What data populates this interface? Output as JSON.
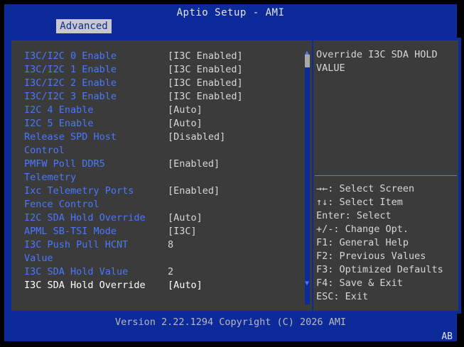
{
  "header": {
    "title": "Aptio Setup - AMI",
    "tab": "Advanced"
  },
  "settings": [
    {
      "label": "I3C/I2C 0 Enable",
      "value": "[I3C Enabled]"
    },
    {
      "label": "I3C/I2C 1 Enable",
      "value": "[I3C Enabled]"
    },
    {
      "label": "I3C/I2C 2 Enable",
      "value": "[I3C Enabled]"
    },
    {
      "label": "I3C/I2C 3 Enable",
      "value": "[I3C Enabled]"
    },
    {
      "label": "I2C 4 Enable",
      "value": "[Auto]"
    },
    {
      "label": "I2C 5 Enable",
      "value": "[Auto]"
    },
    {
      "label": "Release SPD Host",
      "label2": "Control",
      "value": "[Disabled]"
    },
    {
      "label": "PMFW Poll DDR5",
      "label2": "Telemetry",
      "value": "[Enabled]"
    },
    {
      "label": "Ixc Telemetry Ports",
      "label2": "Fence Control",
      "value": "[Enabled]"
    },
    {
      "label": "I2C SDA Hold Override",
      "value": "[Auto]"
    },
    {
      "label": "APML SB-TSI Mode",
      "value": "[I3C]"
    },
    {
      "label": "I3C Push Pull HCNT",
      "label2": "Value",
      "value": "8"
    },
    {
      "label": "I3C SDA Hold Value",
      "value": "2"
    },
    {
      "label": "I3C SDA Hold Override",
      "value": "[Auto]"
    }
  ],
  "help": {
    "text": "Override I3C SDA HOLD\nVALUE"
  },
  "keys": [
    "→←: Select Screen",
    "↑↓: Select Item",
    "Enter: Select",
    "+/-: Change Opt.",
    "F1: General Help",
    "F2: Previous Values",
    "F3: Optimized Defaults",
    "F4: Save & Exit",
    "ESC: Exit"
  ],
  "scroll": {
    "up": "▲",
    "down": "▼"
  },
  "footer": {
    "version": "Version 2.22.1294 Copyright (C) 2026 AMI",
    "corner": "AB"
  },
  "colors": {
    "frame_blue": "#0c2a9a",
    "panel_gray": "#3b3b3b",
    "label_blue": "#4a78ff",
    "text_light": "#d7d7d7"
  }
}
